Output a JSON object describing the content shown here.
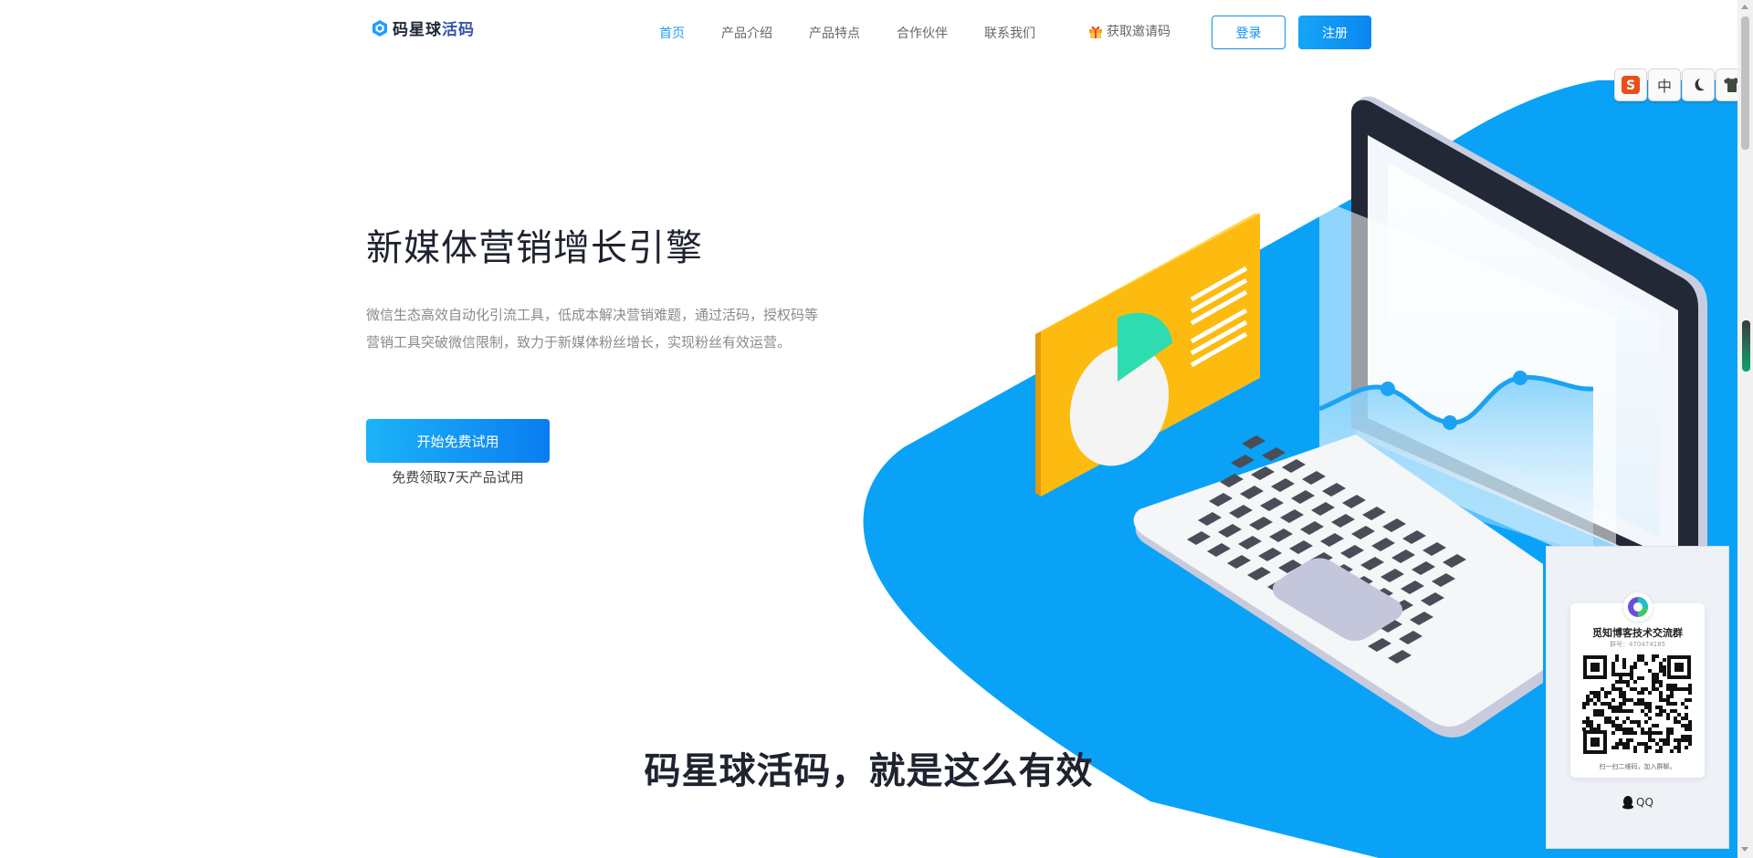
{
  "header": {
    "logo_text": "码星球",
    "logo_suffix": "活码",
    "nav": [
      {
        "label": "首页",
        "active": true
      },
      {
        "label": "产品介绍",
        "active": false
      },
      {
        "label": "产品特点",
        "active": false
      },
      {
        "label": "合作伙伴",
        "active": false
      },
      {
        "label": "联系我们",
        "active": false
      }
    ],
    "invite_label": "获取邀请码",
    "login_label": "登录",
    "register_label": "注册"
  },
  "hero": {
    "title": "新媒体营销增长引擎",
    "description": "微信生态高效自动化引流工具，低成本解决营销难题，通过活码，授权码等营销工具突破微信限制，致力于新媒体粉丝增长，实现粉丝有效运营。",
    "cta_label": "开始免费试用",
    "cta_note": "免费领取7天产品试用"
  },
  "section": {
    "title": "码星球活码，就是这么有效"
  },
  "tools": [
    {
      "icon": "s-logo-icon",
      "label": "S"
    },
    {
      "icon": "chinese-toggle-icon",
      "label": "中"
    },
    {
      "icon": "moon-icon",
      "label": "☽"
    },
    {
      "icon": "shirt-icon",
      "label": "👕"
    }
  ],
  "qr_card": {
    "group_name": "觅知博客技术交流群",
    "group_number": "群号：470474185",
    "hint": "扫一扫二维码，加入群聊。",
    "label": "QQ"
  },
  "colors": {
    "accent": "#1e9fff",
    "primary_button": "#0a87f0",
    "illustration_blue": "#0aa2f7",
    "card_yellow": "#fdbb10",
    "chart_green": "#2edcb0"
  }
}
